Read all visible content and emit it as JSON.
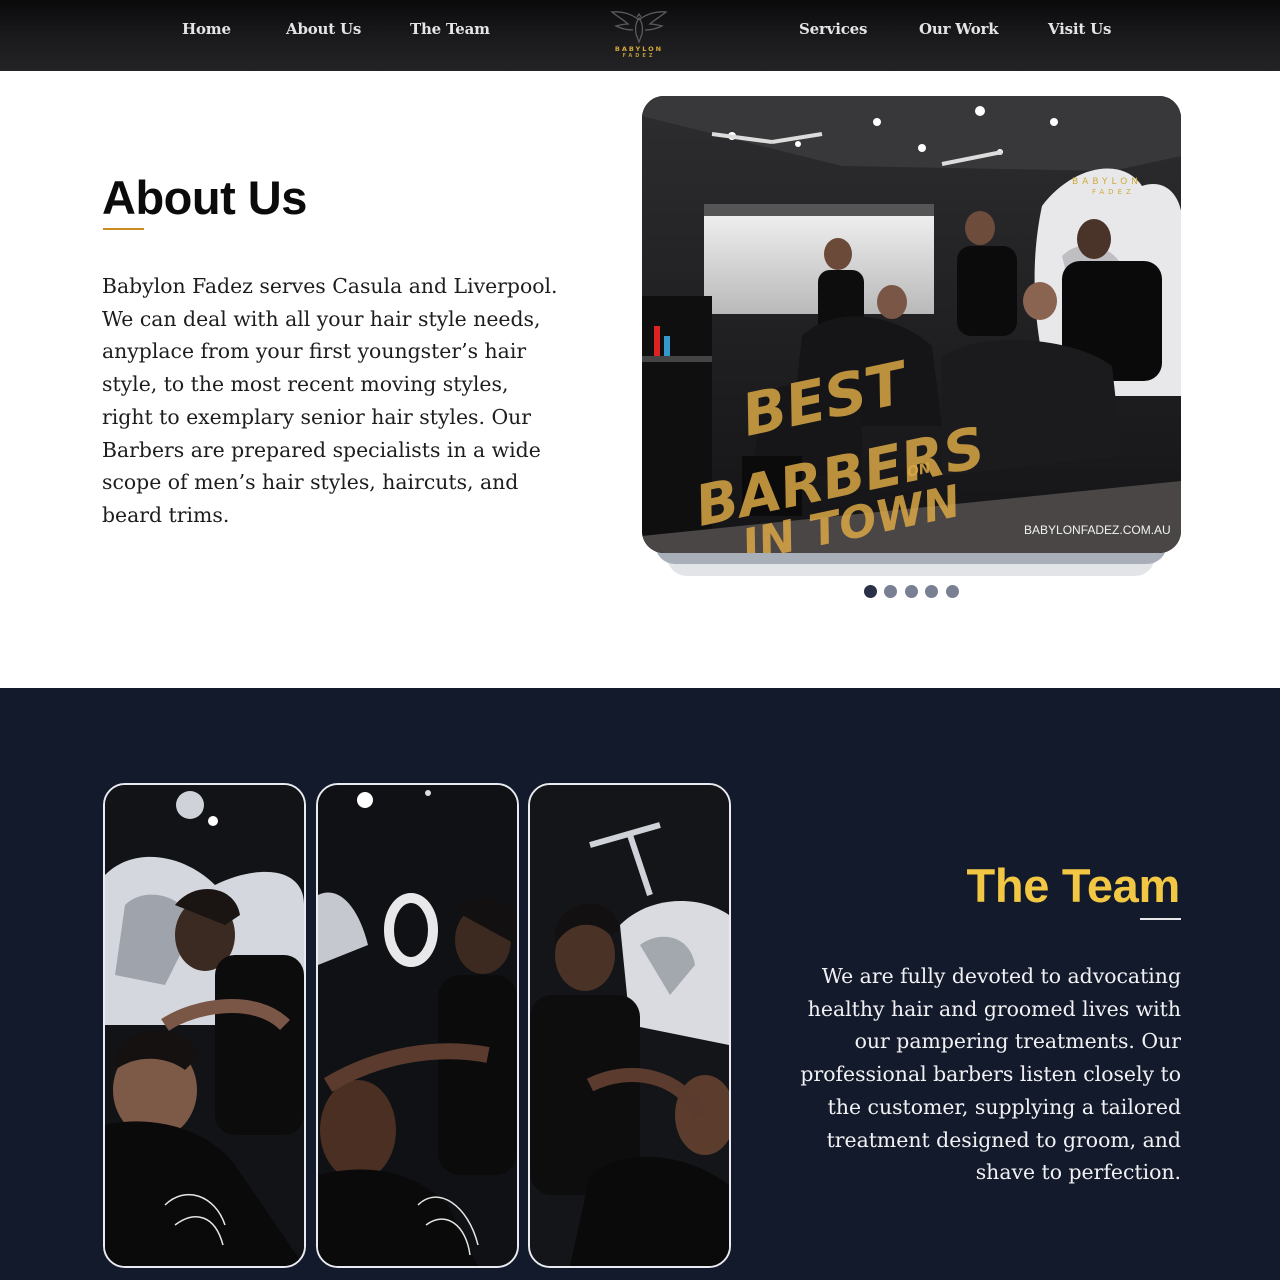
{
  "nav": {
    "left_items": [
      "Home",
      "About Us",
      "The Team"
    ],
    "right_items": [
      "Services",
      "Our Work",
      "Visit Us"
    ],
    "logo_line1": "BABYLON",
    "logo_line2": "FADEZ"
  },
  "about": {
    "title": "About Us",
    "text": "Babylon Fadez serves Casula and Liverpool. We can deal with all your hair style needs, anyplace from your first youngster’s hair style, to the most recent moving styles, right to exemplary senior hair styles. Our Barbers are prepared specialists in a wide scope of men’s hair styles, haircuts, and beard trims.",
    "slider": {
      "overlay_line1": "BEST",
      "overlay_line2": "BARBERS",
      "overlay_line3": "IN TOWN",
      "overlay_small": "ON",
      "url": "BABYLONFADEZ.COM.AU",
      "brand1": "BABYLON",
      "brand2": "FADEZ",
      "slide_count": 5,
      "active_index": 0
    }
  },
  "team": {
    "title": "The Team",
    "text": "We are fully devoted to advocating healthy hair and groomed lives with our pampering treatments. Our professional barbers listen closely to the customer, supplying a tailored treatment designed to groom, and shave to perfection.",
    "photo_count": 3
  },
  "colors": {
    "accent_gold": "#F2C744",
    "underline_orange": "#CC8B1F",
    "navy": "#131A2B",
    "nav_dark": "#1C1C1F"
  }
}
